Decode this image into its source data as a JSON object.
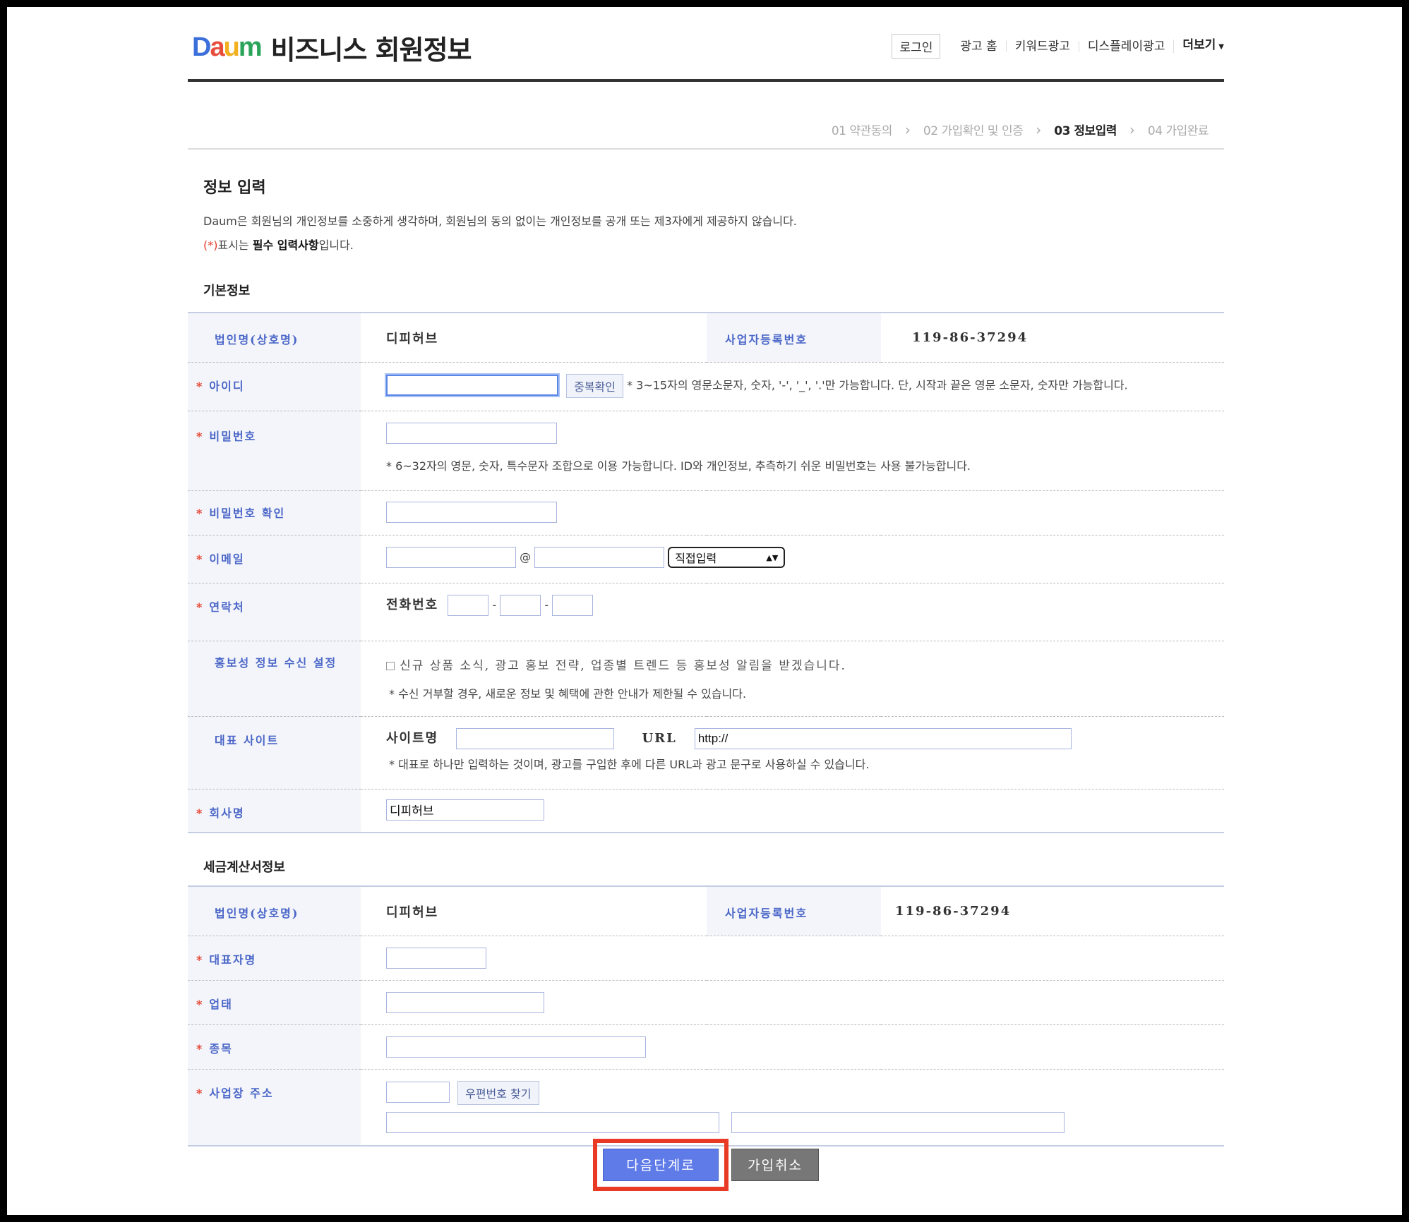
{
  "header": {
    "logo_text": "Daum",
    "title": "비즈니스 회원정보",
    "login": "로그인",
    "nav": [
      "광고 홈",
      "키워드광고",
      "디스플레이광고"
    ],
    "more": "더보기"
  },
  "steps": [
    {
      "label": "01 약관동의",
      "active": false
    },
    {
      "label": "02 가입확인 및 인증",
      "active": false
    },
    {
      "label": "03 정보입력",
      "active": true
    },
    {
      "label": "04 가입완료",
      "active": false
    }
  ],
  "intro": {
    "title": "정보 입력",
    "desc": "Daum은 회원님의 개인정보를 소중하게 생각하며, 회원님의 동의 없이는 개인정보를 공개 또는 제3자에게 제공하지 않습니다.",
    "req_star": "(*)",
    "req_pre": "표시는 ",
    "req_bold": "필수 입력사항",
    "req_post": "입니다."
  },
  "basic": {
    "title": "기본정보",
    "corp_label": "법인명(상호명)",
    "corp_value": "디피허브",
    "brn_label": "사업자등록번호",
    "brn_value": "119-86-37294",
    "id_label": "아이디",
    "id_check": "중복확인",
    "id_hint": "* 3~15자의 영문소문자, 숫자, '-', '_', '.'만 가능합니다. 단, 시작과 끝은 영문 소문자, 숫자만 가능합니다.",
    "pw_label": "비밀번호",
    "pw_hint": "* 6~32자의 영문, 숫자, 특수문자 조합으로 이용 가능합니다. ID와 개인정보, 추측하기 쉬운 비밀번호는 사용 불가능합니다.",
    "pw2_label": "비밀번호 확인",
    "email_label": "이메일",
    "email_at": "@",
    "email_select": "직접입력",
    "contact_label": "연락처",
    "phone_label": "전화번호",
    "dash": "-",
    "promo_label": "홍보성 정보 수신 설정",
    "promo_text": "신규 상품 소식, 광고 홍보 전략, 업종별 트렌드 등 홍보성 알림을 받겠습니다.",
    "promo_hint": "* 수신 거부할 경우, 새로운 정보 및 혜택에 관한 안내가 제한될 수 있습니다.",
    "site_label": "대표 사이트",
    "site_name_label": "사이트명",
    "url_label": "URL",
    "url_value": "http://",
    "site_hint": "* 대표로 하나만 입력하는 것이며, 광고를 구입한 후에 다른 URL과 광고 문구로 사용하실 수 있습니다.",
    "company_label": "회사명",
    "company_value": "디피허브"
  },
  "tax": {
    "title": "세금계산서정보",
    "corp_label": "법인명(상호명)",
    "corp_value": "디피허브",
    "brn_label": "사업자등록번호",
    "brn_value": "119-86-37294",
    "rep_label": "대표자명",
    "type_label": "업태",
    "item_label": "종목",
    "addr_label": "사업장 주소",
    "zip_button": "우편번호 찾기"
  },
  "buttons": {
    "next": "다음단계로",
    "cancel": "가입취소"
  },
  "colors": {
    "accent": "#4a66c8",
    "required": "#e43e2b",
    "highlight": "#e83a24"
  }
}
